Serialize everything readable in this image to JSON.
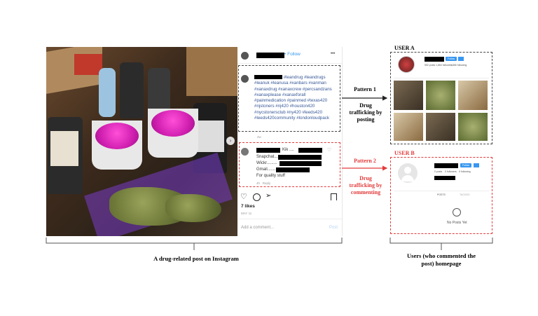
{
  "post": {
    "follow_label": "Follow",
    "more_glyph": "•••",
    "hashtags": "#leandrug #leandrugs #leanuk #leanusa #xanbars #xanman #xanaxdrug #xanaxcrew #percsandzans #xanaxplease #xanaxforall #painmedication #painmed #texas420 #njstoners #nj420 #houston420 #nycstonersclub #ny420 #leeds420 #leeds420community #londonloudpack",
    "caption_time": "2w",
    "comment_lines": [
      "Kik ....",
      "Snapchat....",
      "Wickr.........",
      "Gmail..........",
      "For quality stuff"
    ],
    "comment_time": "4h",
    "reply_label": "Reply",
    "likes": "7 likes",
    "date": "MAY 11",
    "add_comment_placeholder": "Add a comment...",
    "post_button": "Post"
  },
  "patterns": {
    "pattern1_title": "Pattern 1",
    "pattern1_desc": "Drug trafficking by posting",
    "pattern2_title": "Pattern 2",
    "pattern2_desc": "Drug trafficking by commenting"
  },
  "user_a": {
    "label": "USER A",
    "follow_label": "Follow",
    "stats": [
      "552 posts",
      "1,864 followers",
      "1,866 following"
    ]
  },
  "user_b": {
    "label": "USER B",
    "follow_label": "Follow",
    "stats": [
      "0 posts",
      "0 followers",
      "0 following"
    ],
    "posts_tab": "POSTS",
    "tagged_tab": "TAGGED",
    "no_posts": "No Posts Yet"
  },
  "captions": {
    "left": "A drug-related post on Instagram",
    "right": "Users (who commented the post) homepage"
  },
  "colors": {
    "pattern2_red": "#e23b3b",
    "instagram_blue": "#3897f0",
    "hashtag_blue": "#385898"
  }
}
